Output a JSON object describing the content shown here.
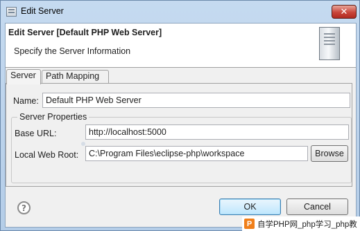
{
  "window": {
    "title": "Edit Server",
    "close_glyph": "✕"
  },
  "header": {
    "title": "Edit Server [Default PHP Web Server]",
    "description": "Specify the Server Information",
    "icon": "server-icon"
  },
  "tabs": [
    {
      "label": "Server",
      "active": true
    },
    {
      "label": "Path Mapping",
      "active": false
    }
  ],
  "form": {
    "name_label": "Name:",
    "name_value": "Default PHP Web Server",
    "group_title": "Server Properties",
    "base_url_label": "Base URL:",
    "base_url_value": "http://localhost:5000",
    "root_label": "Local Web Root:",
    "root_value": "C:\\Program Files\\eclipse-php\\workspace",
    "browse_label": "Browse"
  },
  "footer": {
    "help_glyph": "?",
    "ok_label": "OK",
    "cancel_label": "Cancel"
  },
  "watermark": {
    "logo_glyph": "P",
    "text": "自学PHP网_php学习_php教"
  },
  "colors": {
    "accent": "#3c7fb1",
    "close": "#c9453a",
    "watermark": "#f07f1a"
  }
}
